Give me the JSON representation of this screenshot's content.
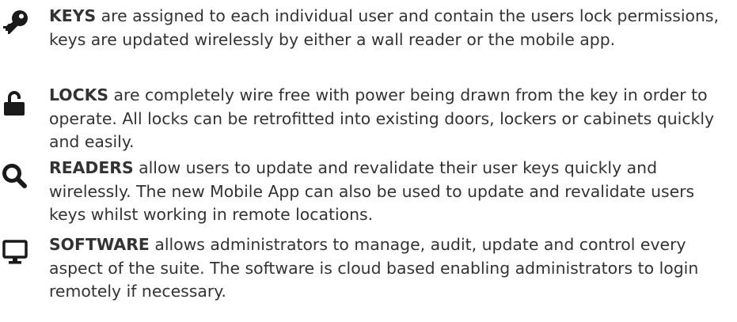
{
  "features": [
    {
      "icon": "key-icon",
      "heading": "KEYS",
      "description": " are assigned to each individual user and contain the users lock permissions, keys are updated wirelessly by either a wall reader or the mobile app."
    },
    {
      "icon": "unlocked-padlock-icon",
      "heading": "LOCKS",
      "description": " are completely wire free with power being drawn from the key in order to operate. All locks can be retrofitted into existing doors, lockers or cabinets quickly and easily."
    },
    {
      "icon": "search-icon",
      "heading": "READERS",
      "description": " allow users to update and revalidate their user keys quickly and wirelessly. The new Mobile App can also be used to update and revalidate users keys whilst working in remote locations."
    },
    {
      "icon": "desktop-monitor-icon",
      "heading": "SOFTWARE",
      "description": " allows administrators to manage, audit, update and control every aspect of the suite. The software is cloud based enabling administrators to login remotely if necessary."
    }
  ],
  "colors": {
    "icon": "#1a1a1a",
    "text": "#333333"
  }
}
